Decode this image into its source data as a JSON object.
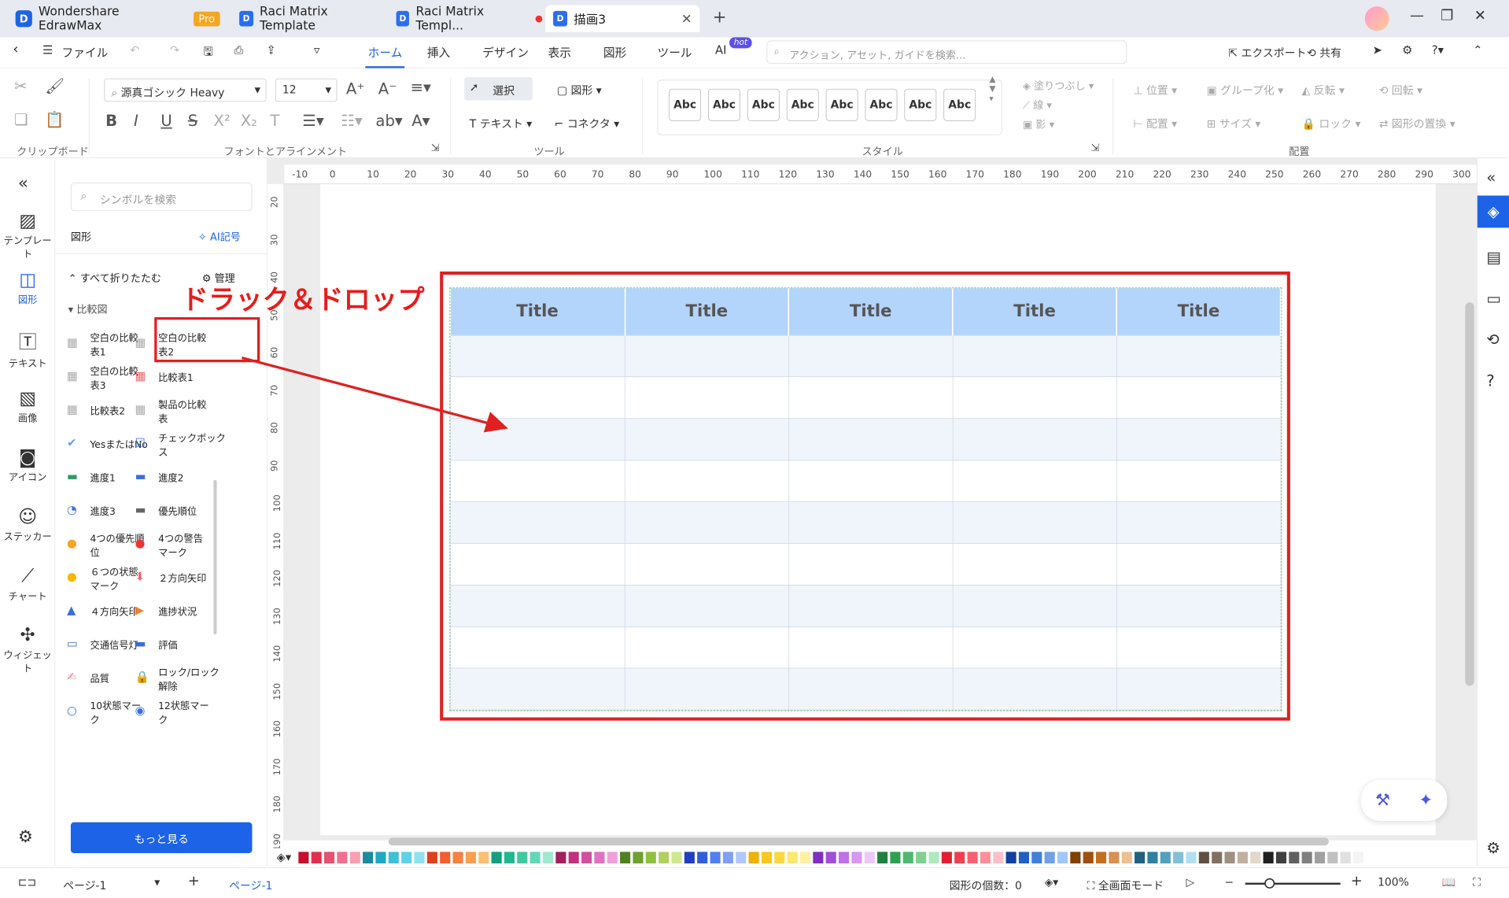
{
  "titlebar": {
    "app_name": "Wondershare EdrawMax",
    "pro_badge": "Pro",
    "tabs": [
      {
        "label": "Raci Matrix Template"
      },
      {
        "label": "Raci Matrix Templ..."
      },
      {
        "label": "描画3"
      }
    ]
  },
  "menubar": {
    "file": "ファイル",
    "items": [
      "ホーム",
      "挿入",
      "デザイン",
      "表示",
      "図形",
      "ツール",
      "AI"
    ],
    "selected": "ホーム",
    "hot_badge": "hot",
    "search_placeholder": "アクション, アセット, ガイドを検索...",
    "export": "エクスポート",
    "share": "共有"
  },
  "ribbon": {
    "font_name": "源真ゴシック Heavy",
    "font_size": "12",
    "select": "選択",
    "shape": "図形",
    "text": "テキスト",
    "connector": "コネクタ",
    "style_sample": "Abc",
    "fill": "塗りつぶし",
    "line": "線",
    "shadow": "影",
    "position": "位置",
    "group": "グループ化",
    "flip": "反転",
    "rotate": "回転",
    "align": "配置",
    "size": "サイズ",
    "lock": "ロック",
    "replace": "図形の置換",
    "labels": {
      "clipboard": "クリップボード",
      "font": "フォントとアラインメント",
      "tools": "ツール",
      "style": "スタイル",
      "arrange": "配置"
    }
  },
  "rail": [
    "テンプレート",
    "図形",
    "テキスト",
    "画像",
    "アイコン",
    "ステッカー",
    "チャート",
    "ウィジェット"
  ],
  "library": {
    "search_placeholder": "シンボルを検索",
    "shapes_title": "図形",
    "ai_symbol": "AI記号",
    "collapse_all": "すべて折りたたむ",
    "manage": "管理",
    "category": "比較図",
    "items": [
      {
        "l1": "空白の比較",
        "l2": "表1"
      },
      {
        "l1": "空白の比較",
        "l2": "表2"
      },
      {
        "l1": "空白の比較",
        "l2": "表3"
      },
      {
        "l1": "比較表1",
        "l2": ""
      },
      {
        "l1": "比較表2",
        "l2": ""
      },
      {
        "l1": "製品の比較",
        "l2": "表"
      },
      {
        "l1": "YesまたはNo",
        "l2": ""
      },
      {
        "l1": "チェックボック",
        "l2": "ス"
      },
      {
        "l1": "進度1",
        "l2": ""
      },
      {
        "l1": "進度2",
        "l2": ""
      },
      {
        "l1": "進度3",
        "l2": ""
      },
      {
        "l1": "優先順位",
        "l2": ""
      },
      {
        "l1": "4つの優先順",
        "l2": "位"
      },
      {
        "l1": "4つの警告",
        "l2": "マーク"
      },
      {
        "l1": "６つの状態",
        "l2": "マーク"
      },
      {
        "l1": "２方向矢印",
        "l2": ""
      },
      {
        "l1": "４方向矢印",
        "l2": ""
      },
      {
        "l1": "進捗状況",
        "l2": ""
      },
      {
        "l1": "交通信号灯",
        "l2": ""
      },
      {
        "l1": "評価",
        "l2": ""
      },
      {
        "l1": "品質",
        "l2": ""
      },
      {
        "l1": "ロック/ロック",
        "l2": "解除"
      },
      {
        "l1": "10状態マー",
        "l2": "ク"
      },
      {
        "l1": "12状態マー",
        "l2": "ク"
      }
    ],
    "more_button": "もっと見る"
  },
  "annotation": "ドラック＆ドロップ",
  "table": {
    "headers": [
      "Title",
      "Title",
      "Title",
      "Title",
      "Title"
    ]
  },
  "ruler": {
    "h": [
      "-10",
      "0",
      "10",
      "20",
      "30",
      "40",
      "50",
      "60",
      "70",
      "80",
      "90",
      "100",
      "110",
      "120",
      "130",
      "140",
      "150",
      "160",
      "170",
      "180",
      "190",
      "200",
      "210",
      "220",
      "230",
      "240",
      "250",
      "260",
      "270",
      "280",
      "290",
      "300"
    ],
    "v": [
      "20",
      "30",
      "40",
      "50",
      "60",
      "70",
      "80",
      "90",
      "100",
      "110",
      "120",
      "130",
      "140",
      "150",
      "160",
      "170",
      "180",
      "190"
    ]
  },
  "statusbar": {
    "page_select": "ページ-1",
    "page_tab": "ページ-1",
    "shape_count": "図形の個数：0",
    "fullscreen": "全画面モード",
    "zoom": "100%"
  },
  "colors": {
    "accent": "#1d63e8",
    "highlight_red": "#e02020",
    "table_header": "#b3d4fb"
  }
}
